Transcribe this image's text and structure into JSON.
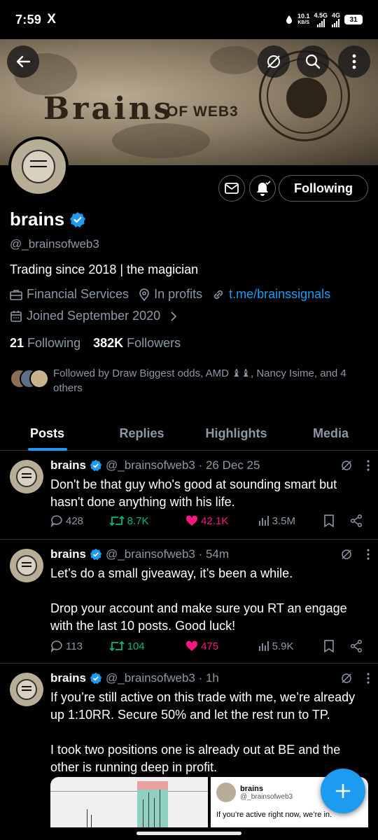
{
  "status_bar": {
    "time": "7:59",
    "app_icon": "X",
    "net_speed": "10.1",
    "net_unit": "KB/S",
    "sig1": "4.5G",
    "sig2": "4G",
    "battery": "31"
  },
  "banner": {
    "brand": "Brains",
    "brand_sub": "OF WEB3"
  },
  "header": {
    "back_icon": "arrow-left-icon",
    "grok_icon": "grok-icon",
    "search_icon": "search-icon",
    "more_icon": "more-vertical-icon"
  },
  "profile": {
    "name": "brains",
    "handle": "@_brainsofweb3",
    "bio": "Trading since 2018 | the magician",
    "category": "Financial Services",
    "location": "In profits",
    "link": "t.me/brainssignals",
    "joined": "Joined September 2020",
    "following_count": "21",
    "following_label": "Following",
    "followers_count": "382K",
    "followers_label": "Followers",
    "followed_by": "Followed by Draw Biggest odds, AMD ♝♝, Nancy Isime, and 4 others",
    "follow_button": "Following",
    "verified_color": "#1d9bf0"
  },
  "tabs": [
    "Posts",
    "Replies",
    "Highlights",
    "Media"
  ],
  "posts": [
    {
      "name": "brains",
      "meta": "@_brainsofweb3 · 26 Dec 25",
      "text": "Don't be that guy who's good at sounding smart but hasn't done anything with his life.",
      "replies": "428",
      "reposts": "8.7K",
      "likes": "42.1K",
      "views": "3.5M",
      "liked": true
    },
    {
      "name": "brains",
      "meta": "@_brainsofweb3 · 54m",
      "text": "Let’s do a small giveaway, it’s been a while.\n\nDrop your account and make sure you RT an engage with the last 10 posts. Good luck!",
      "replies": "113",
      "reposts": "104",
      "likes": "475",
      "views": "5.9K",
      "liked": true
    },
    {
      "name": "brains",
      "meta": "@_brainsofweb3 · 1h",
      "text": "If you’re still active on this trade with me, we’re already up 1:10RR. Secure 50% and let the rest run to TP.\n\nI took two positions one is already out at BE and the other is running deep in profit."
    }
  ],
  "quote_card": {
    "name": "brains",
    "handle": "@_brainsofweb3",
    "text": "If you’re active right now, we’re in."
  },
  "colors": {
    "accent": "#1d9bf0",
    "repost": "#00ba7c",
    "like": "#f91880",
    "muted": "#8b98a5"
  }
}
